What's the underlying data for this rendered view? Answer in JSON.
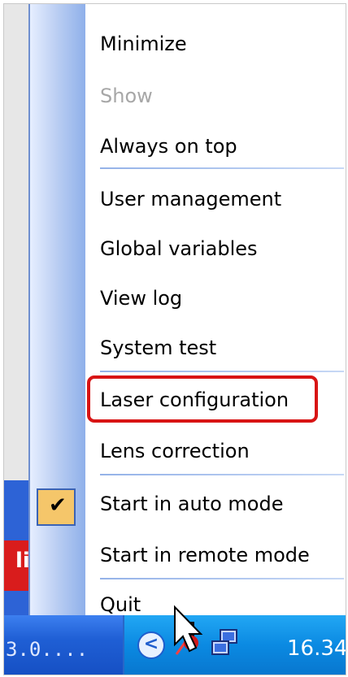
{
  "menu": {
    "items": [
      {
        "label": "Minimize",
        "enabled": true
      },
      {
        "label": "Show",
        "enabled": false
      },
      {
        "label": "Always on top",
        "enabled": true
      },
      {
        "label": "User management",
        "enabled": true
      },
      {
        "label": "Global variables",
        "enabled": true
      },
      {
        "label": "View log",
        "enabled": true
      },
      {
        "label": "System test",
        "enabled": true
      },
      {
        "label": "Laser configuration",
        "enabled": true,
        "highlighted": true
      },
      {
        "label": "Lens correction",
        "enabled": true
      },
      {
        "label": "Start in auto mode",
        "enabled": true,
        "checked": true
      },
      {
        "label": "Start in remote mode",
        "enabled": true
      },
      {
        "label": "Quit",
        "enabled": true
      }
    ]
  },
  "taskbar": {
    "truncated_text": "3.0....",
    "clock": "16.34"
  },
  "background": {
    "partial_label": "li"
  },
  "colors": {
    "highlight_border": "#d81414",
    "menu_gutter": "#b9cdf2",
    "taskbar": "#1f5fd5",
    "tray": "#0b8ae2",
    "check_background": "#f5c66a"
  }
}
